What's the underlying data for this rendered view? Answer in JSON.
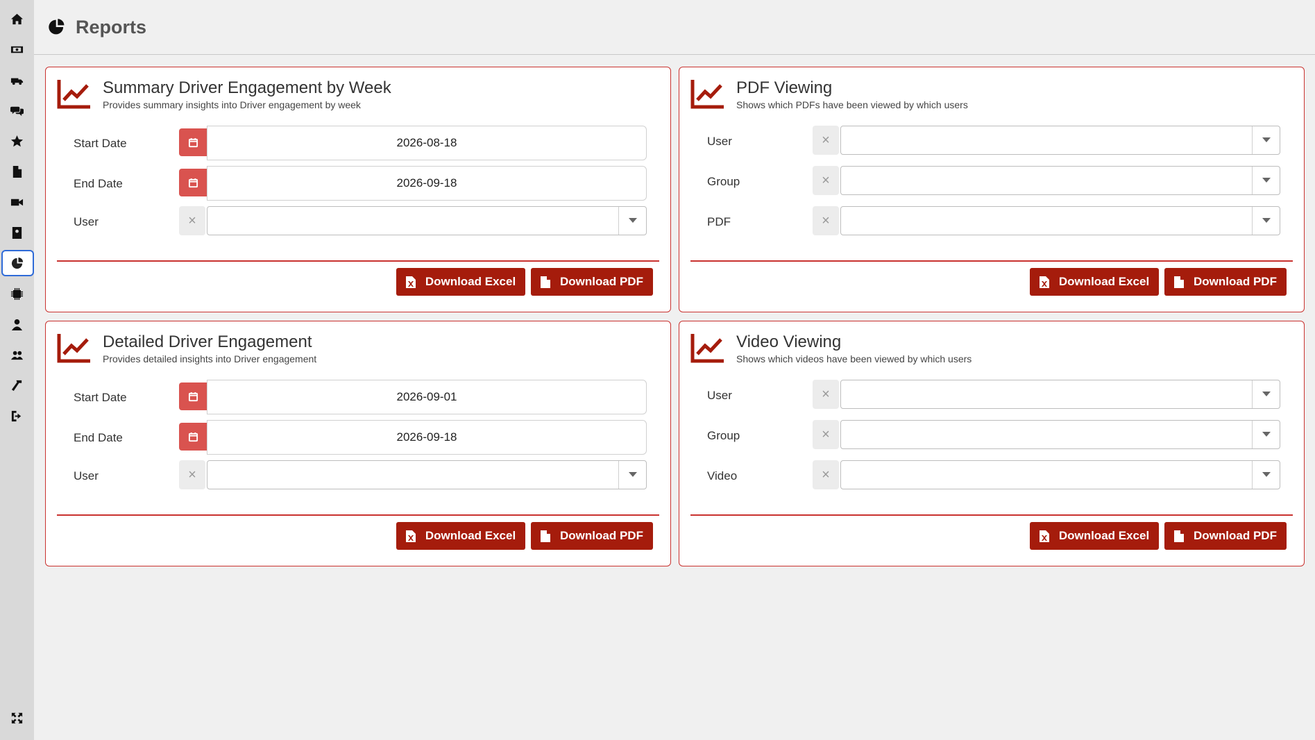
{
  "header": {
    "title": "Reports"
  },
  "sidebar": {
    "items": [
      {
        "icon": "home-icon"
      },
      {
        "icon": "money-icon"
      },
      {
        "icon": "truck-icon"
      },
      {
        "icon": "chat-icon"
      },
      {
        "icon": "star-icon"
      },
      {
        "icon": "pdf-file-icon"
      },
      {
        "icon": "video-camera-icon"
      },
      {
        "icon": "address-book-icon"
      },
      {
        "icon": "pie-chart-icon",
        "active": true
      },
      {
        "icon": "chip-icon"
      },
      {
        "icon": "user-icon"
      },
      {
        "icon": "users-icon"
      },
      {
        "icon": "hammer-icon"
      },
      {
        "icon": "logout-icon"
      }
    ],
    "bottom_icon": "expand-icon"
  },
  "cards": [
    {
      "title": "Summary Driver Engagement by Week",
      "subtitle": "Provides summary insights into Driver engagement by week",
      "start_label": "Start Date",
      "start_value": "2026-08-18",
      "end_label": "End Date",
      "end_value": "2026-09-18",
      "user_label": "User"
    },
    {
      "title": "PDF Viewing",
      "subtitle": "Shows which PDFs have been viewed by which users",
      "f1_label": "User",
      "f2_label": "Group",
      "f3_label": "PDF"
    },
    {
      "title": "Detailed Driver Engagement",
      "subtitle": "Provides detailed insights into Driver engagement",
      "start_label": "Start Date",
      "start_value": "2026-09-01",
      "end_label": "End Date",
      "end_value": "2026-09-18",
      "user_label": "User"
    },
    {
      "title": "Video Viewing",
      "subtitle": "Shows which videos have been viewed by which users",
      "f1_label": "User",
      "f2_label": "Group",
      "f3_label": "Video"
    }
  ],
  "buttons": {
    "excel": "Download Excel",
    "pdf": "Download PDF"
  },
  "colors": {
    "accent": "#a51c0c",
    "border": "#c9322f",
    "calendar": "#d9534f",
    "active_nav": "#2f6bd8"
  }
}
